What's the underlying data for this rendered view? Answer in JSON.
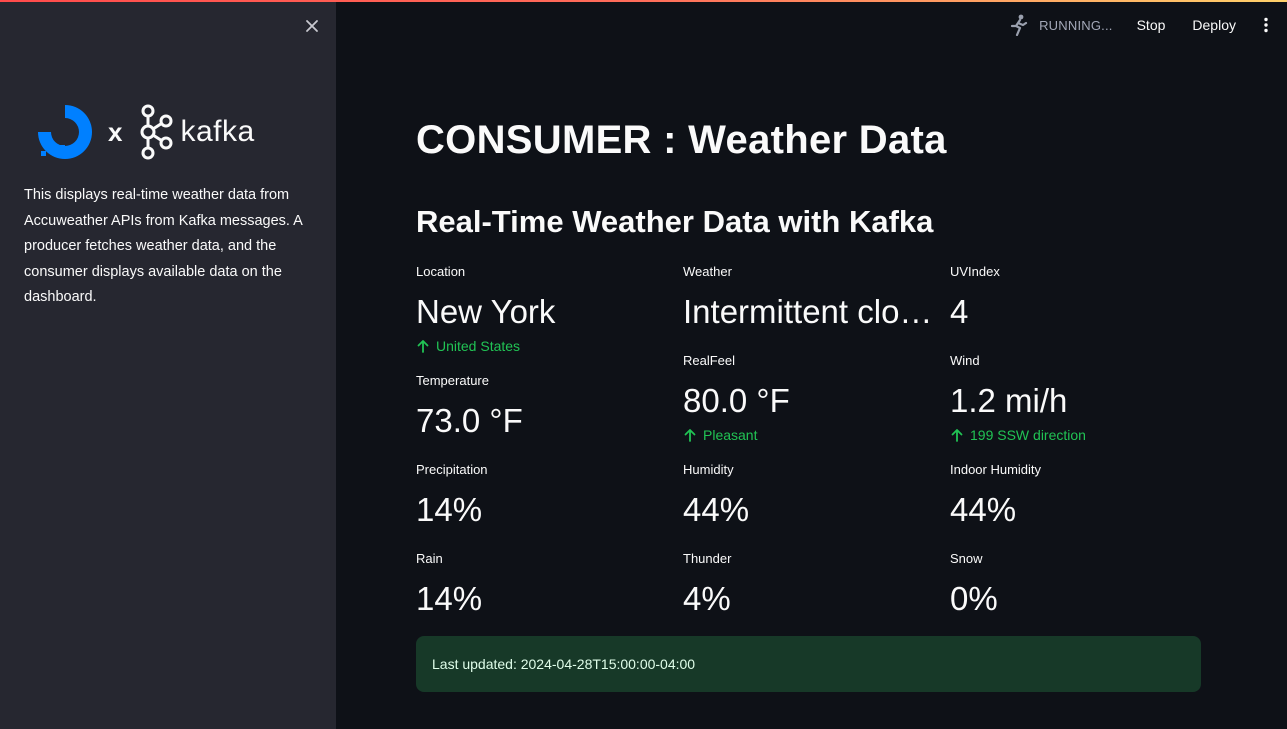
{
  "header": {
    "status": "RUNNING...",
    "stop_label": "Stop",
    "deploy_label": "Deploy"
  },
  "sidebar": {
    "logo_separator": "x",
    "kafka_logo_text": "kafka",
    "description": "This displays real-time weather data from Accuweather APIs from Kafka messages. A producer fetches weather data, and the consumer displays available data on the dashboard."
  },
  "main": {
    "title": "CONSUMER : Weather Data",
    "subtitle": "Real-Time Weather Data with Kafka",
    "metrics": [
      {
        "label": "Location",
        "value": "New York",
        "delta": "United States"
      },
      {
        "label": "Weather",
        "value": "Intermittent clouds"
      },
      {
        "label": "UVIndex",
        "value": "4"
      },
      {
        "label": "Temperature",
        "value": "73.0 °F"
      },
      {
        "label": "RealFeel",
        "value": "80.0 °F",
        "delta": "Pleasant"
      },
      {
        "label": "Wind",
        "value": "1.2 mi/h",
        "delta": "199 SSW direction"
      },
      {
        "label": "Precipitation",
        "value": "14%"
      },
      {
        "label": "Humidity",
        "value": "44%"
      },
      {
        "label": "Indoor Humidity",
        "value": "44%"
      },
      {
        "label": "Rain",
        "value": "14%"
      },
      {
        "label": "Thunder",
        "value": "4%"
      },
      {
        "label": "Snow",
        "value": "0%"
      }
    ],
    "last_updated": "Last updated: 2024-04-28T15:00:00-04:00"
  },
  "colors": {
    "background": "#0e1117",
    "sidebar": "#262730",
    "delta_positive": "#21c354",
    "success_box": "#173928",
    "do_blue": "#0080ff"
  }
}
